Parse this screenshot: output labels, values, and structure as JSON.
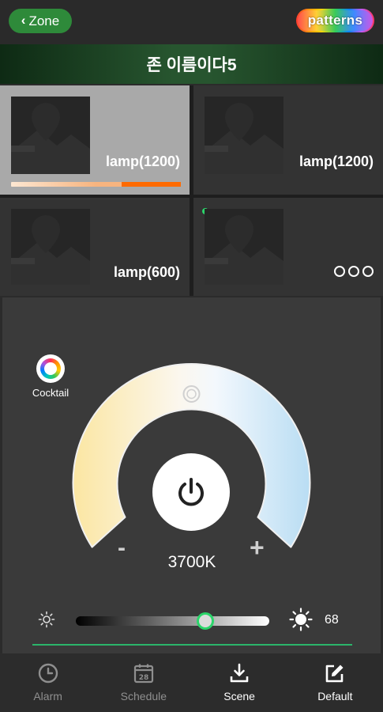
{
  "topbar": {
    "back_label": "Zone",
    "patterns_label": "patterns"
  },
  "zone": {
    "title": "존 이름이다5"
  },
  "lamps": [
    {
      "name": "lamp(1200)",
      "selected": true,
      "progress": 0.65
    },
    {
      "name": "lamp(1200)",
      "selected": false
    },
    {
      "name": "lamp(600)",
      "selected": false
    },
    {
      "name": "",
      "selected": false,
      "online_dot": true,
      "more_icon": "more-dots-icon"
    }
  ],
  "control": {
    "cocktail_label": "Cocktail",
    "minus_label": "-",
    "plus_label": "+",
    "color_temp": "3700K",
    "brightness_value": "68",
    "brightness_level": 0.67
  },
  "nav": [
    {
      "label": "Alarm",
      "icon": "clock-icon",
      "active": false
    },
    {
      "label": "Schedule",
      "icon": "calendar-icon",
      "calendar_day": "28",
      "active": false
    },
    {
      "label": "Scene",
      "icon": "download-icon",
      "active": true
    },
    {
      "label": "Default",
      "icon": "edit-icon",
      "active": true
    }
  ],
  "colors": {
    "accent_green": "#2bd56a",
    "zone_button": "#2e8a3a",
    "progress_orange": "#ff6a00"
  }
}
